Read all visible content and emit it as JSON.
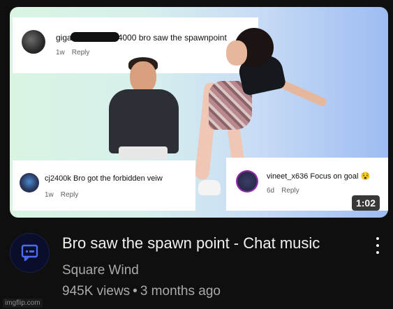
{
  "thumbnail": {
    "duration": "1:02",
    "comments": [
      {
        "user_prefix": "giga",
        "user_suffix": "4000",
        "text": "bro saw the spawnpoint",
        "age": "1w",
        "reply": "Reply"
      },
      {
        "user": "cj2400k",
        "text": "Bro got the forbidden veiw",
        "age": "1w",
        "reply": "Reply"
      },
      {
        "user": "vineet_x636",
        "text": "Focus on goal 😵",
        "age": "6d",
        "reply": "Reply"
      }
    ]
  },
  "video": {
    "title": "Bro saw the spawn point - Chat music",
    "channel": "Square Wind",
    "views": "945K views",
    "separator": "•",
    "age": "3 months ago"
  },
  "watermark": "imgflip.com",
  "colors": {
    "background": "#0f0f0f",
    "title": "#f1f1f1",
    "secondary": "#aaaaaa"
  },
  "icons": [
    "more-vert-icon",
    "channel-chat-icon"
  ]
}
